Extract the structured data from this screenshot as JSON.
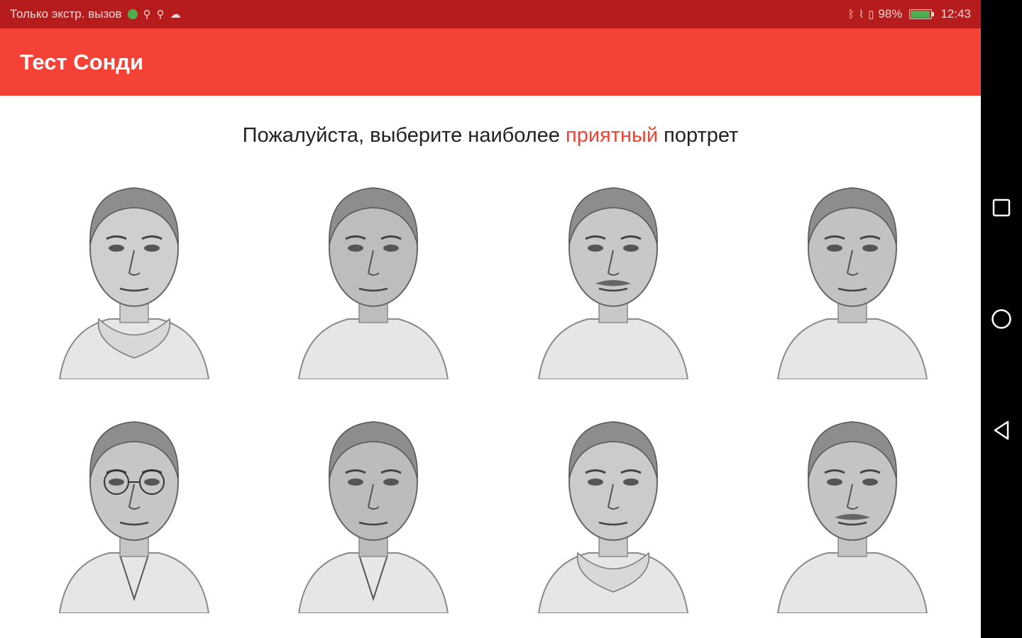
{
  "status_bar": {
    "carrier_text": "Только экстр. вызов",
    "battery_percent": "98%",
    "time": "12:43",
    "icons": [
      "globe-icon",
      "usb-icon",
      "usb-icon",
      "cloud-icon",
      "bluetooth-icon",
      "vibrate-icon",
      "sim-icon",
      "battery-icon"
    ]
  },
  "app_bar": {
    "title": "Тест Сонди"
  },
  "prompt": {
    "before": "Пожалуйста, выберите наиболее ",
    "highlight": "приятный",
    "after": " портрет"
  },
  "portraits": [
    {
      "shirt": "scarf"
    },
    {
      "shirt": "bare"
    },
    {
      "shirt": "plaid"
    },
    {
      "shirt": "fur"
    },
    {
      "shirt": "suit-glasses"
    },
    {
      "shirt": "jacket"
    },
    {
      "shirt": "scarf-light"
    },
    {
      "shirt": "shirt-beard"
    }
  ],
  "nav": [
    "recents-icon",
    "home-icon",
    "back-icon"
  ],
  "colors": {
    "accent": "#f44336",
    "status_bar": "#b71c1c"
  }
}
